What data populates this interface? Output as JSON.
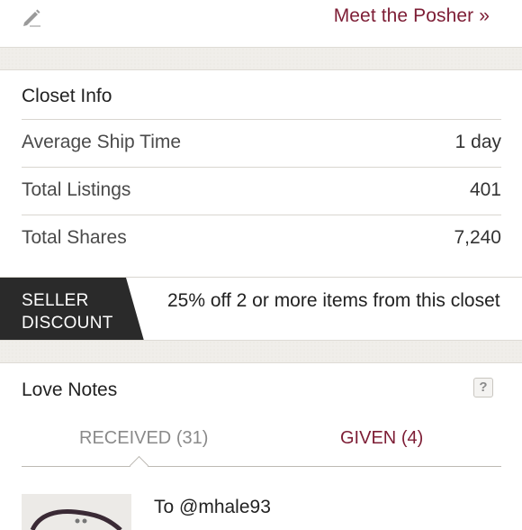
{
  "header": {
    "meet_link": "Meet the Posher »",
    "edit_icon": "pencil-icon"
  },
  "closet_info": {
    "title": "Closet Info",
    "rows": [
      {
        "label": "Average Ship Time",
        "value": "1 day"
      },
      {
        "label": "Total Listings",
        "value": "401"
      },
      {
        "label": "Total Shares",
        "value": "7,240"
      }
    ]
  },
  "seller_discount": {
    "tag_line1": "SELLER",
    "tag_line2": "DISCOUNT",
    "text": "25% off 2 or more items from this closet"
  },
  "love_notes": {
    "title": "Love Notes",
    "help_label": "?",
    "tabs": [
      {
        "label": "RECEIVED",
        "count": "(31)",
        "active": true
      },
      {
        "label": "GIVEN",
        "count": "(4)",
        "active": false
      }
    ],
    "notes": [
      {
        "to": "To @mhale93"
      }
    ]
  },
  "colors": {
    "accent": "#7d1d35",
    "tag_bg": "#2a2a2a",
    "band": "#f0eeea"
  }
}
